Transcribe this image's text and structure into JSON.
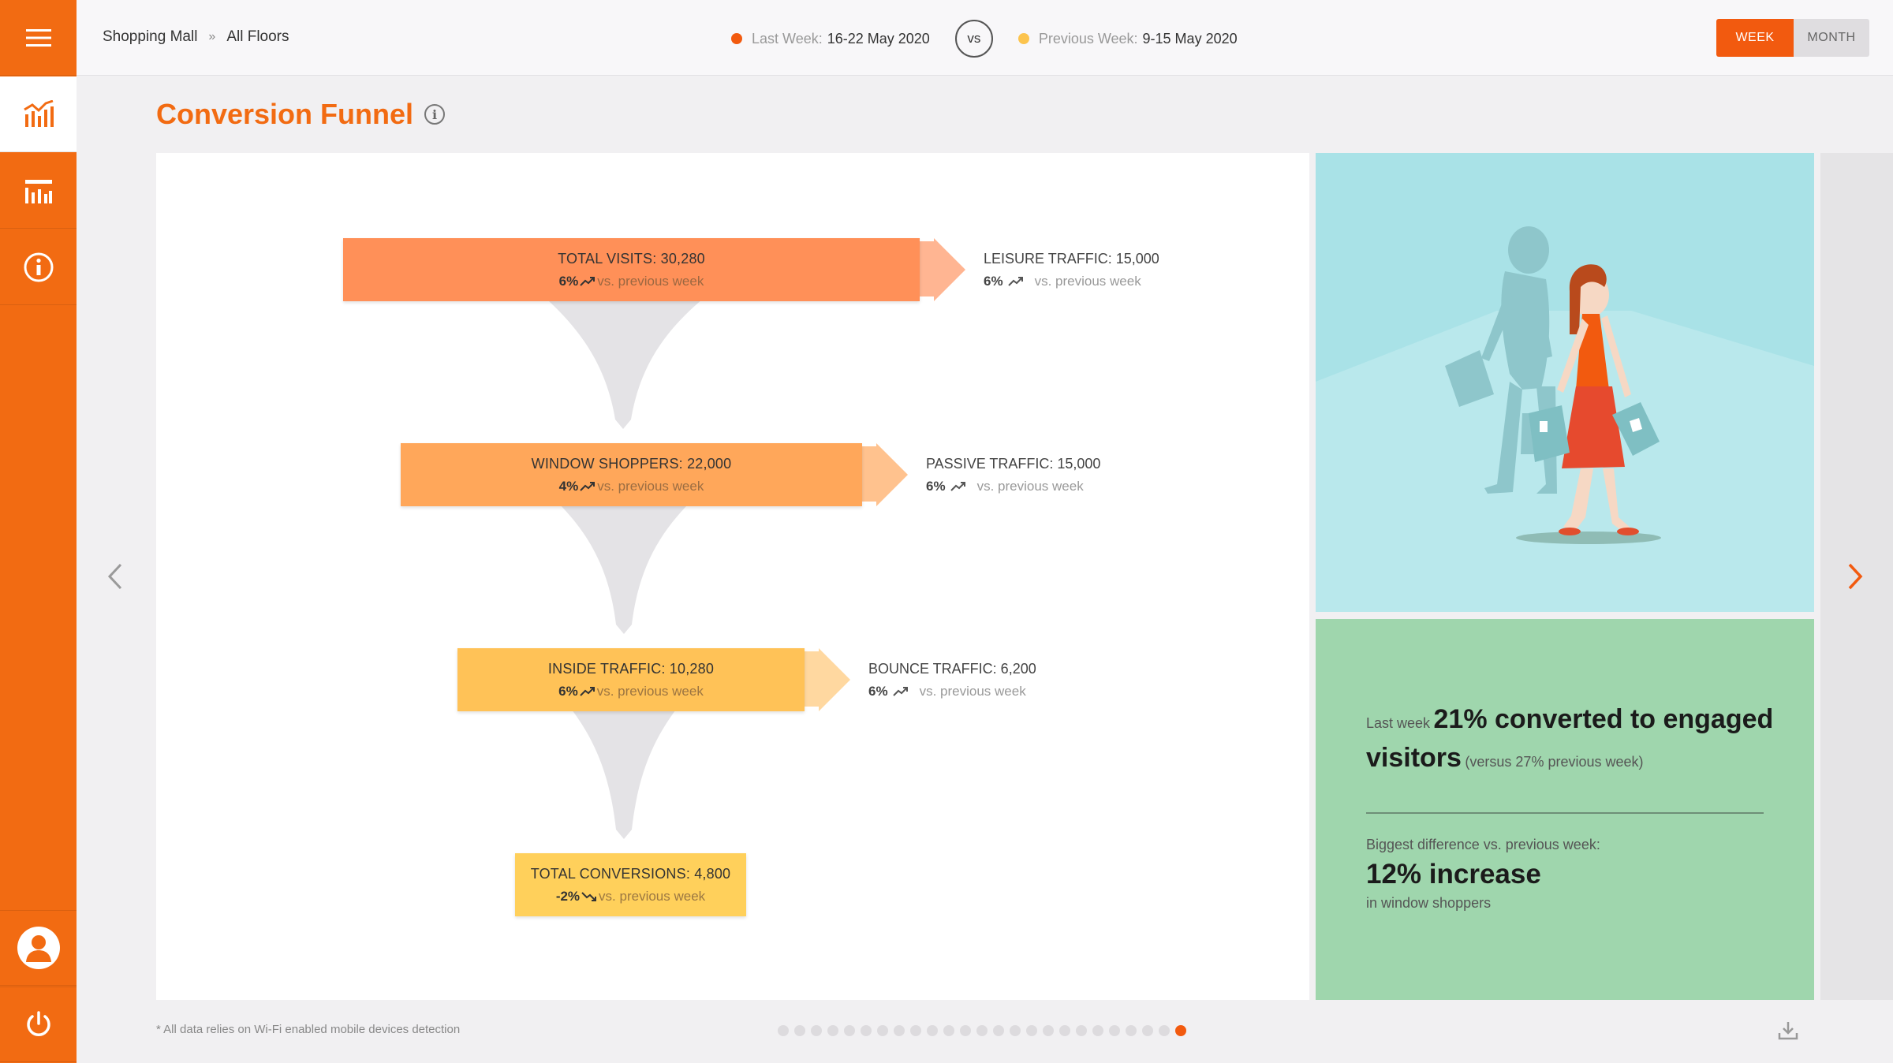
{
  "breadcrumb": {
    "root": "Shopping Mall",
    "separator": "»",
    "current": "All Floors"
  },
  "compare": {
    "last_label": "Last Week:",
    "last_value": "16-22 May 2020",
    "last_color": "#f25a0f",
    "vs": "vs",
    "prev_label": "Previous Week:",
    "prev_value": "9-15 May 2020",
    "prev_color": "#fcc44e"
  },
  "period": {
    "week": "WEEK",
    "month": "MONTH",
    "selected": "WEEK"
  },
  "title": "Conversion Funnel",
  "info_glyph": "i",
  "sidebar": {
    "items": [
      {
        "icon": "menu-icon"
      },
      {
        "icon": "line-chart-icon",
        "active": true
      },
      {
        "icon": "bar-chart-icon"
      },
      {
        "icon": "info-icon"
      }
    ],
    "bottom": [
      {
        "icon": "user-icon"
      },
      {
        "icon": "power-icon"
      }
    ]
  },
  "funnel": {
    "stages": [
      {
        "label": "TOTAL VISITS: 30,280",
        "pct": "6%",
        "trend": "up",
        "vs": "vs. previous week",
        "color": "#ff9058"
      },
      {
        "label": "WINDOW SHOPPERS: 22,000",
        "pct": "4%",
        "trend": "up",
        "vs": "vs. previous week",
        "color": "#ffa75a"
      },
      {
        "label": "INSIDE TRAFFIC: 10,280",
        "pct": "6%",
        "trend": "up",
        "vs": "vs. previous week",
        "color": "#ffc257"
      },
      {
        "label": "TOTAL CONVERSIONS: 4,800",
        "pct": "-2%",
        "trend": "down",
        "vs": "vs. previous week",
        "color": "#ffd05b"
      }
    ],
    "side": [
      {
        "label": "LEISURE TRAFFIC: 15,000",
        "pct": "6%",
        "trend": "up",
        "vs": "vs. previous week",
        "color": "#ffb592"
      },
      {
        "label": "PASSIVE TRAFFIC: 15,000",
        "pct": "6%",
        "trend": "up",
        "vs": "vs. previous week",
        "color": "#ffc28e"
      },
      {
        "label": "BOUNCE TRAFFIC: 6,200",
        "pct": "6%",
        "trend": "up",
        "vs": "vs. previous week",
        "color": "#ffd8a0"
      }
    ]
  },
  "insight": {
    "prefix": "Last week",
    "headline": "21% converted to engaged visitors",
    "note": "(versus 27% previous week)",
    "diff_label": "Biggest difference vs. previous week:",
    "diff_value": "12% increase",
    "diff_sub": "in window shoppers"
  },
  "footnote": "* All data relies on Wi-Fi enabled mobile devices detection",
  "pager": {
    "total": 25,
    "active": 25
  }
}
